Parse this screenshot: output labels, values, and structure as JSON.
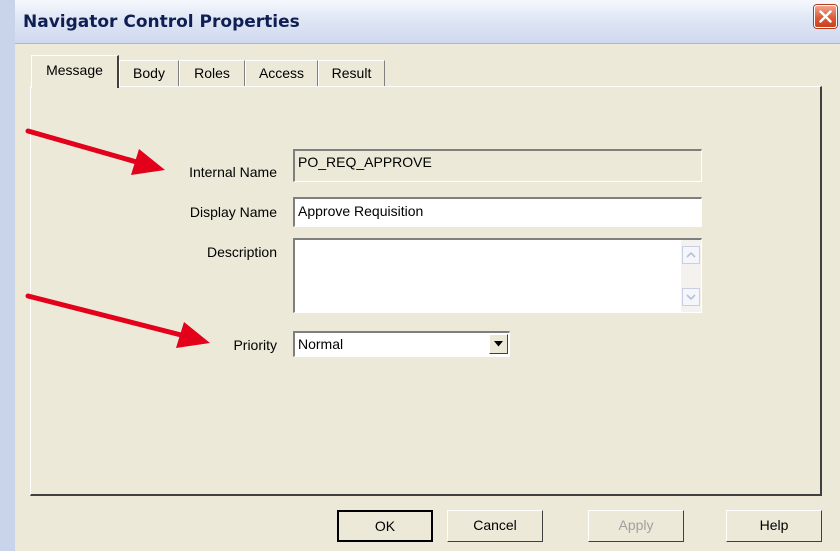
{
  "window": {
    "title": "Navigator Control Properties"
  },
  "tabs": [
    {
      "label": "Message",
      "active": true
    },
    {
      "label": "Body",
      "active": false
    },
    {
      "label": "Roles",
      "active": false
    },
    {
      "label": "Access",
      "active": false
    },
    {
      "label": "Result",
      "active": false
    }
  ],
  "form": {
    "internal_name": {
      "label": "Internal Name",
      "value": "PO_REQ_APPROVE"
    },
    "display_name": {
      "label": "Display  Name",
      "value": "Approve Requisition"
    },
    "description": {
      "label": "Description",
      "value": ""
    },
    "priority": {
      "label": "Priority",
      "value": "Normal"
    }
  },
  "buttons": {
    "ok": "OK",
    "cancel": "Cancel",
    "apply": "Apply",
    "help": "Help"
  },
  "colors": {
    "annotation_arrow": "#e3001b",
    "title_text": "#0f1f54",
    "dialog_bg": "#ece9d8"
  },
  "icons": [
    "close-icon",
    "scroll-up-icon",
    "scroll-down-icon",
    "dropdown-arrow-icon"
  ]
}
